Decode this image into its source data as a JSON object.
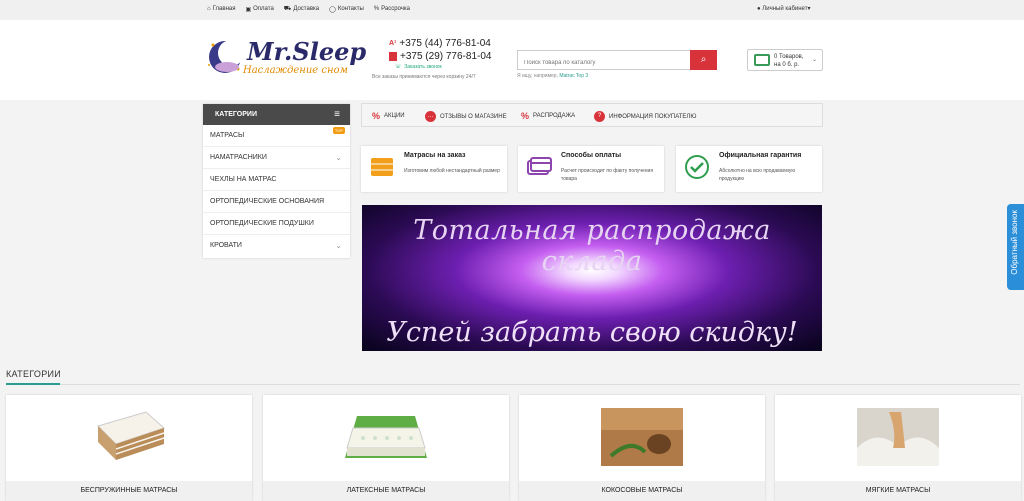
{
  "topbar": {
    "links": [
      {
        "icon": "home-icon",
        "glyph": "⌂",
        "label": "Главная"
      },
      {
        "icon": "payment-icon",
        "glyph": "▣",
        "label": "Оплата"
      },
      {
        "icon": "truck-icon",
        "glyph": "⛟",
        "label": "Доставка"
      },
      {
        "icon": "chat-icon",
        "glyph": "◯",
        "label": "Контакты"
      },
      {
        "icon": "percent-icon",
        "glyph": "%",
        "label": "Рассрочка"
      }
    ],
    "account": "Личный кабинет"
  },
  "header": {
    "logo_title": "Mr.Sleep",
    "logo_slogan": "Наслаждение сном",
    "phone1": "+375 (44) 776-81-04",
    "phone2": "+375 (29) 776-81-04",
    "callback_link": "Заказать звонок",
    "orders_note": "Все заказы принимаются через корзину 24/7",
    "search_placeholder": "Поиск товара по каталогу",
    "search_hint_prefix": "Я ищу, например,",
    "search_hint_link": "Matrac Top 3",
    "cart_line1": "0 Товаров,",
    "cart_line2": "на 0 б. р."
  },
  "sidebar": {
    "title": "КАТЕГОРИИ",
    "items": [
      {
        "label": "МАТРАСЫ",
        "badge": "TOP",
        "chevron": ""
      },
      {
        "label": "НАМАТРАСНИКИ",
        "badge": "",
        "chevron": "⌄"
      },
      {
        "label": "ЧЕХЛЫ НА МАТРАС",
        "badge": "",
        "chevron": ""
      },
      {
        "label": "ОРТОПЕДИЧЕСКИЕ ОСНОВАНИЯ",
        "badge": "",
        "chevron": ""
      },
      {
        "label": "ОРТОПЕДИЧЕСКИЕ ПОДУШКИ",
        "badge": "",
        "chevron": ""
      },
      {
        "label": "КРОВАТИ",
        "badge": "",
        "chevron": "⌄"
      }
    ]
  },
  "menubar": {
    "items": [
      {
        "label": "АКЦИИ",
        "icon": "percent-icon"
      },
      {
        "label": "ОТЗЫВЫ О МАГАЗИНЕ",
        "icon": "review-icon"
      },
      {
        "label": "РАСПРОДАЖА",
        "icon": "sale-icon"
      },
      {
        "label": "ИНФОРМАЦИЯ ПОКУПАТЕЛЮ",
        "icon": "info-icon"
      }
    ]
  },
  "features": [
    {
      "title": "Матрасы на заказ",
      "desc": "Изготовим любой нестандартный размер",
      "icon": "mattress-icon"
    },
    {
      "title": "Способы оплаты",
      "desc": "Расчет происходит по факту получения товара",
      "icon": "card-icon"
    },
    {
      "title": "Официальная гарантия",
      "desc": "Абсолютно на всю продаваемую продукцию",
      "icon": "check-icon"
    }
  ],
  "banner": {
    "line1": "Тотальная распродажа склада",
    "line2": "Успей забрать свою скидку!"
  },
  "categories": {
    "title": "КАТЕГОРИИ",
    "cards": [
      {
        "label": "БЕСПРУЖИННЫЕ МАТРАСЫ"
      },
      {
        "label": "ЛАТЕКСНЫЕ МАТРАСЫ"
      },
      {
        "label": "КОКОСОВЫЕ МАТРАСЫ"
      },
      {
        "label": "МЯГКИЕ МАТРАСЫ"
      }
    ]
  },
  "callback_widget": "Обратный звонок",
  "colors": {
    "accent": "#d8333a",
    "teal": "#2a9d8f",
    "dark": "#4a4a4a",
    "widget": "#2b8ed8"
  }
}
